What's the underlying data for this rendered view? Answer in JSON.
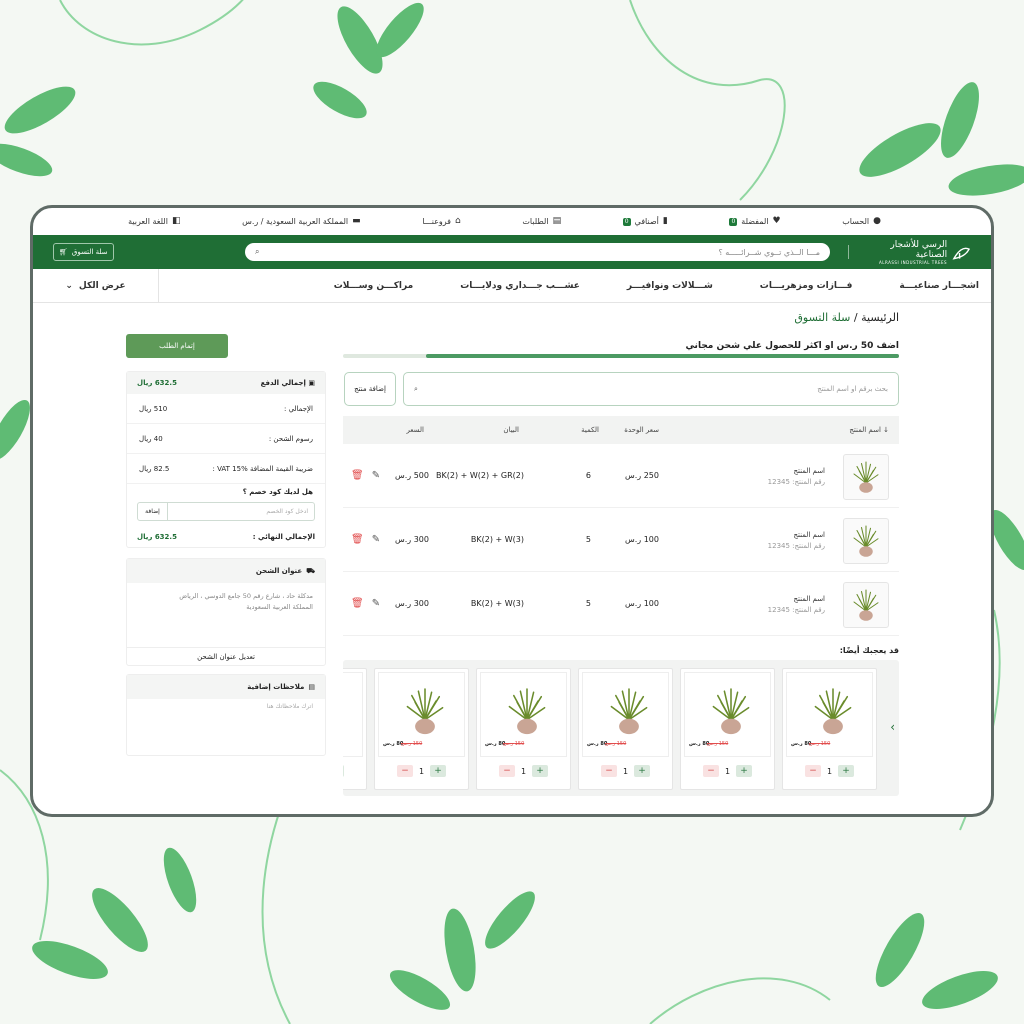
{
  "topbar": {
    "account": "الحساب",
    "favorites": "المفضلة",
    "favorites_count": "0",
    "my_items": "أصنافي",
    "my_items_count": "0",
    "orders": "الطلبات",
    "branches": "فروعنـــا",
    "country": "المملكة العربية السعودية / ر.س",
    "language": "اللغة العربية"
  },
  "header": {
    "logo_ar": "الرسي للأشجار الصناعية",
    "logo_en": "ALRASSI INDUSTRIAL TREES",
    "search_placeholder": "مـــا الــذي تــوي شــرائـــــه ؟",
    "cart_label": "سلة التسوق"
  },
  "categories": [
    "اشجـــار صناعيـــة",
    "فـــازات ومزهريـــات",
    "شـــلالات ونوافيـــر",
    "عشـــب جـــداري ودلايـــات",
    "مراكـــن وســـلات"
  ],
  "view_all": "عرض الكل",
  "breadcrumb": {
    "home": "الرئيسية /",
    "current": "سلة التسوق"
  },
  "promo_text": "اضف 50 ر.س او اكثر للحصول علي شحن مجاني",
  "promo_progress": 0.85,
  "product_search_placeholder": "بحث برقم او اسم المنتج",
  "add_product": "إضافة منتج",
  "table": {
    "headers": {
      "name": "اسم المنتج",
      "unit_price": "سعر الوحدة",
      "qty": "الكمية",
      "details": "البيان",
      "price": "السعر"
    },
    "rows": [
      {
        "name": "اسم المنتج",
        "sku": "رقم المنتج: 12345",
        "unit_price": "250 ر.س",
        "qty": "6",
        "details": "BK(2) + W(2) + GR(2)",
        "price": "500 ر.س"
      },
      {
        "name": "اسم المنتج",
        "sku": "رقم المنتج: 12345",
        "unit_price": "100 ر.س",
        "qty": "5",
        "details": "BK(2) + W(3)",
        "price": "300 ر.س"
      },
      {
        "name": "اسم المنتج",
        "sku": "رقم المنتج: 12345",
        "unit_price": "100 ر.س",
        "qty": "5",
        "details": "BK(2) + W(3)",
        "price": "300 ر.س"
      }
    ]
  },
  "summary": {
    "finish_button": "إتمام الطلب",
    "total_pay_label": "إجمالي الدفع",
    "total_pay_value": "632.5 ريال",
    "subtotal_label": "الإجمالي :",
    "subtotal_value": "510 ريال",
    "shipping_label": "رسوم الشحن :",
    "shipping_value": "40 ريال",
    "vat_label": "ضريبة القيمة المضافة  VAT 15% :",
    "vat_value": "82.5 ريال",
    "coupon_question": "هل لديك كود خصم ؟",
    "coupon_placeholder": "ادخل كود الخصم",
    "coupon_button": "إضافة",
    "final_label": "الإجمالي النهائي :",
    "final_value": "632.5 ريال"
  },
  "shipping": {
    "title": "عنوان الشحن",
    "address_line1": "مدكلة حاد ، شارع رقم 50 جامع الدوسي ، الرياض",
    "address_line2": "المملكة العربية السعودية",
    "edit": "تعديل عنوان الشحن"
  },
  "notes": {
    "title": "ملاحظات إضافية",
    "placeholder": "اترك ملاحظاتك هنا"
  },
  "may_like": "قد يعجبك أيضًا:",
  "cards": [
    {
      "price": "80 ر.س",
      "old": "150 ر.س",
      "qty": "1"
    },
    {
      "price": "80 ر.س",
      "old": "150 ر.س",
      "qty": "1"
    },
    {
      "price": "80 ر.س",
      "old": "150 ر.س",
      "qty": "1"
    },
    {
      "price": "80 ر.س",
      "old": "150 ر.س",
      "qty": "1"
    },
    {
      "price": "80 ر.س",
      "old": "150 ر.س",
      "qty": "1"
    },
    {
      "price": "80 ر.س",
      "old": "150 ر.س",
      "qty": "1"
    }
  ],
  "colors": {
    "brand": "#1f6e35",
    "accent": "#5e9a58",
    "danger": "#e14c4c"
  }
}
